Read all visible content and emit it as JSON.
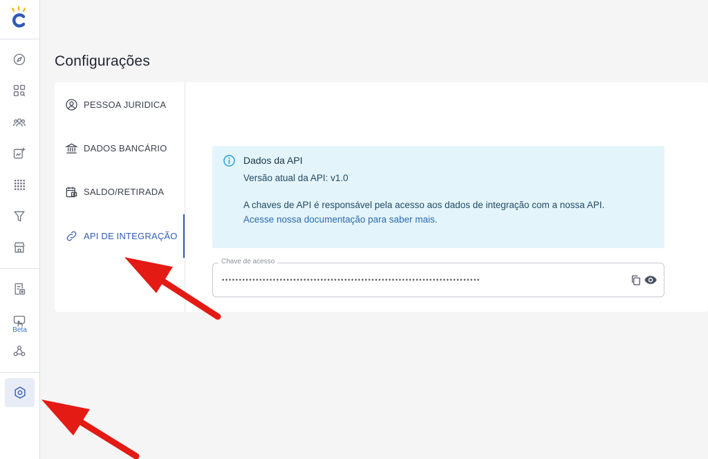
{
  "app": {
    "brand_color": "#2f5bb7",
    "logo": "brand-logo",
    "sidebar": {
      "icons": [
        "compass-icon",
        "apps-search-icon",
        "users-icon",
        "image-plus-icon",
        "grid-dots-icon",
        "filter-icon",
        "store-icon",
        "invoice-icon",
        "touch-screen-icon",
        "webhook-icon",
        "settings-icon"
      ],
      "beta_label": "Beta",
      "active": "settings-icon"
    }
  },
  "page": {
    "title": "Configurações"
  },
  "tabs": [
    {
      "label": "PESSOA JURIDICA",
      "icon": "user-circle-icon"
    },
    {
      "label": "DADOS BANCÁRIO",
      "icon": "bank-icon"
    },
    {
      "label": "SALDO/RETIRADA",
      "icon": "wallet-calendar-icon"
    },
    {
      "label": "API DE INTEGRAÇÃO",
      "icon": "link-icon",
      "active": true
    }
  ],
  "api_info": {
    "title": "Dados da API",
    "version_text": "Versão atual da API: v1.0",
    "description": "A chaves de API é responsável pela acesso aos dados de integração com a nossa API.",
    "link_text": "Acesse nossa documentação para saber mais.",
    "info_color": "#1f9ed8"
  },
  "access_key": {
    "label": "Chave de acesso",
    "value": "••••••••••••••••••••••••••••••••••••••••••••••••••••••••••••••••••••••••••••"
  },
  "annotations": {
    "arrow_color": "#e31b14"
  }
}
